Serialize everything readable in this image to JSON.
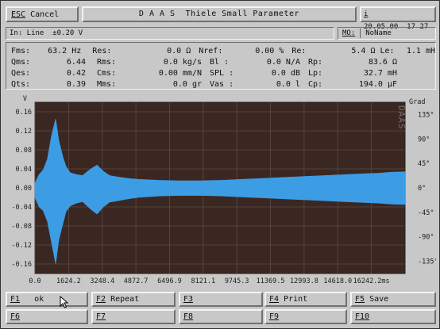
{
  "top": {
    "esc_key": "ESC",
    "esc_label": "Cancel",
    "title": "D A A S  Thiele Small Parameter",
    "date_key": "i",
    "datetime": "20.05.00  17 27"
  },
  "info": {
    "line": "In: Line  ±0.20 V",
    "name_label": "MO:",
    "name_value": "NoName"
  },
  "params": [
    {
      "l1": "Fms:",
      "v1": "63.2 Hz",
      "l2": "Res:",
      "v2": "0.0 Ω",
      "l3": "Nref:",
      "v3": "0.00 %",
      "l4": "Re:",
      "v4": "5.4 Ω",
      "l5": "Le:",
      "v5": "1.1 mH"
    },
    {
      "l1": "Qms:",
      "v1": "6.44",
      "l2": "Rms:",
      "v2": "0.0 kg/s",
      "l3": "Bl :",
      "v3": "0.0 N/A",
      "l4": "Rp:",
      "v4": "83.6 Ω",
      "l5": "",
      "v5": ""
    },
    {
      "l1": "Qes:",
      "v1": "0.42",
      "l2": "Cms:",
      "v2": "0.00 mm/N",
      "l3": "SPL :",
      "v3": "0.0 dB",
      "l4": "Lp:",
      "v4": "32.7 mH",
      "l5": "",
      "v5": ""
    },
    {
      "l1": "Qts:",
      "v1": "0.39",
      "l2": "Mms:",
      "v2": "0.0 gr",
      "l3": "Vas :",
      "v3": "0.0 l",
      "l4": "Cp:",
      "v4": "194.0 µF",
      "l5": "",
      "v5": ""
    }
  ],
  "chart_data": {
    "type": "area",
    "left_axis_unit": "V",
    "right_axis_unit": "Grad",
    "watermark": "DAAS",
    "ylim": [
      -0.18,
      0.18
    ],
    "y_ticks": [
      "0.16",
      "0.12",
      "0.08",
      "0.04",
      "0.00",
      "-0.04",
      "-0.08",
      "-0.12",
      "-0.16"
    ],
    "y_tick_values": [
      0.16,
      0.12,
      0.08,
      0.04,
      0.0,
      -0.04,
      -0.08,
      -0.12,
      -0.16
    ],
    "right_ticks": [
      "135°",
      "90°",
      "45°",
      "0°",
      "-45°",
      "-90°",
      "-135°"
    ],
    "right_tick_values": [
      135,
      90,
      45,
      0,
      -45,
      -90,
      -135
    ],
    "right_lim": [
      -157.5,
      157.5
    ],
    "x_ticks": [
      "0.0",
      "1624.2",
      "3248.4",
      "4872.7",
      "6496.9",
      "8121.1",
      "9745.3",
      "11369.5",
      "12993.8",
      "14618.0",
      "16242.2ms"
    ],
    "xlim": [
      0,
      17866.4
    ],
    "grid": true,
    "series": [
      {
        "color": "#3d9de4",
        "x": [
          0,
          200,
          400,
          600,
          800,
          1000,
          1150,
          1350,
          1500,
          1700,
          2000,
          2300,
          2700,
          3000,
          3300,
          3600,
          4000,
          4500,
          5000,
          6000,
          7000,
          8000,
          9000,
          10000,
          11000,
          12000,
          13000,
          14000,
          15000,
          16000,
          16600,
          17200,
          17866
        ],
        "upper": [
          0.01,
          0.028,
          0.038,
          0.06,
          0.11,
          0.145,
          0.1,
          0.065,
          0.045,
          0.032,
          0.028,
          0.026,
          0.04,
          0.048,
          0.035,
          0.026,
          0.023,
          0.02,
          0.018,
          0.016,
          0.015,
          0.015,
          0.016,
          0.018,
          0.02,
          0.022,
          0.024,
          0.026,
          0.028,
          0.03,
          0.031,
          0.033,
          0.034
        ],
        "lower": [
          -0.02,
          -0.04,
          -0.048,
          -0.07,
          -0.115,
          -0.16,
          -0.11,
          -0.075,
          -0.05,
          -0.038,
          -0.032,
          -0.029,
          -0.045,
          -0.055,
          -0.04,
          -0.03,
          -0.027,
          -0.023,
          -0.02,
          -0.017,
          -0.016,
          -0.016,
          -0.017,
          -0.019,
          -0.021,
          -0.023,
          -0.025,
          -0.027,
          -0.029,
          -0.031,
          -0.032,
          -0.034,
          -0.035
        ]
      }
    ]
  },
  "fkeys": [
    {
      "key": "F1",
      "label": "ok"
    },
    {
      "key": "F2",
      "label": "Repeat"
    },
    {
      "key": "F3",
      "label": ""
    },
    {
      "key": "F4",
      "label": "Print"
    },
    {
      "key": "F5",
      "label": "Save"
    },
    {
      "key": "F6",
      "label": ""
    },
    {
      "key": "F7",
      "label": ""
    },
    {
      "key": "F8",
      "label": ""
    },
    {
      "key": "F9",
      "label": ""
    },
    {
      "key": "F10",
      "label": ""
    }
  ]
}
